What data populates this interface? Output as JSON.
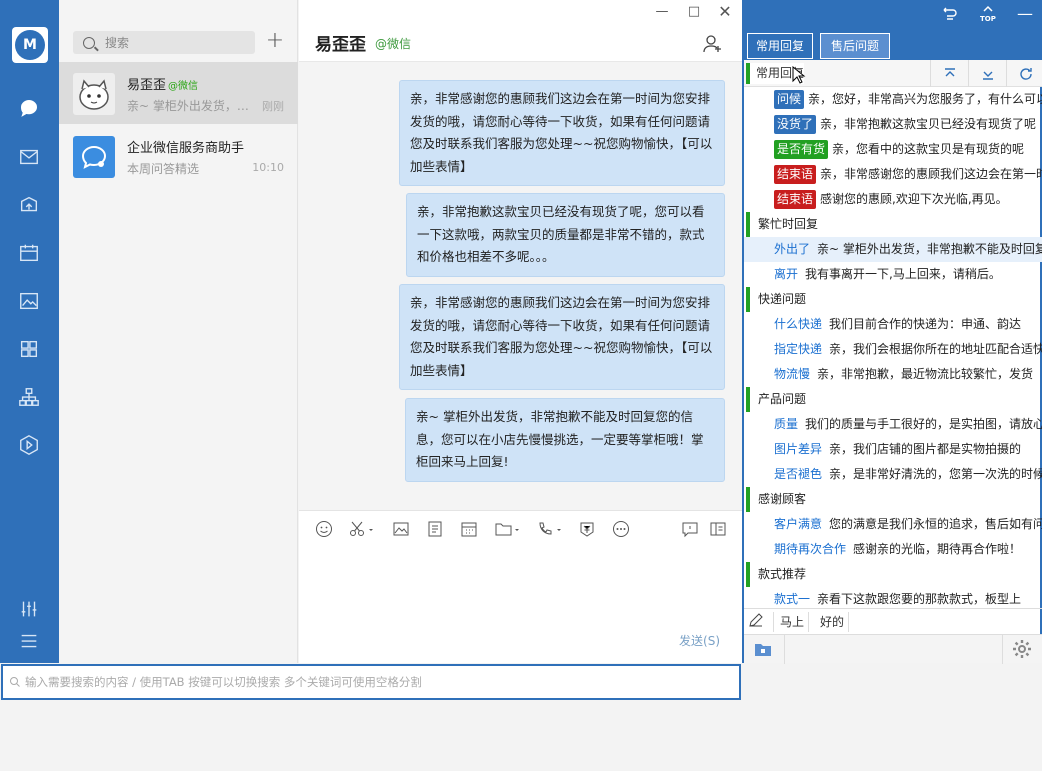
{
  "sidebar": {
    "logo_text": "M",
    "icons": [
      "chat-icon",
      "mail-icon",
      "box-icon",
      "calendar-icon",
      "image-icon",
      "apps-icon",
      "org-icon",
      "play-icon"
    ],
    "bottom_icons": [
      "settings-sliders-icon",
      "menu-icon"
    ]
  },
  "convlist": {
    "search_placeholder": "搜索",
    "items": [
      {
        "name": "易歪歪",
        "tag": "@微信",
        "preview": "亲~ 掌柜外出发货，非常抱歉不能及时回复",
        "time": "刚刚"
      },
      {
        "name": "企业微信服务商助手",
        "tag": "",
        "preview": "本周问答精选",
        "time": "10:10"
      }
    ]
  },
  "chat": {
    "title": "易歪歪",
    "subtitle": "@微信",
    "messages": [
      "亲，非常感谢您的惠顾我们这边会在第一时间为您安排发货的哦，请您耐心等待一下收货，如果有任何问题请您及时联系我们客服为您处理~~祝您购物愉快，【可以加些表情】",
      "亲，非常抱歉这款宝贝已经没有现货了呢，您可以看一下这款哦，两款宝贝的质量都是非常不错的，款式和价格也相差不多呢。。。",
      "亲，非常感谢您的惠顾我们这边会在第一时间为您安排发货的哦，请您耐心等待一下收货，如果有任何问题请您及时联系我们客服为您处理~~祝您购物愉快，【可以加些表情】",
      "亲~ 掌柜外出发货，非常抱歉不能及时回复您的信息，您可以在小店先慢慢挑选，一定要等掌柜哦！掌柜回来马上回复!"
    ],
    "send_label": "发送(S)"
  },
  "panel": {
    "tabs": [
      "常用回复",
      "售后问题"
    ],
    "first_group": "常用回复",
    "rows": [
      {
        "type": "item",
        "tag": "问候",
        "tag_color": "#2f70b9",
        "text": "亲，您好，非常高兴为您服务了，有什么可以帮您的"
      },
      {
        "type": "item",
        "tag": "没货了",
        "tag_color": "#2f70b9",
        "text": "亲，非常抱歉这款宝贝已经没有现货了呢"
      },
      {
        "type": "item",
        "tag": "是否有货",
        "tag_color": "#22a022",
        "text": "亲，您看中的这款宝贝是有现货的呢"
      },
      {
        "type": "item",
        "tag": "结束语",
        "tag_color": "#c81e1e",
        "text": "亲，非常感谢您的惠顾我们这边会在第一时间"
      },
      {
        "type": "item",
        "tag": "结束语",
        "tag_color": "#c81e1e",
        "text": "感谢您的惠顾,欢迎下次光临,再见。"
      },
      {
        "type": "group",
        "text": "繁忙时回复"
      },
      {
        "type": "link",
        "tag": "外出了",
        "text": "亲~ 掌柜外出发货，非常抱歉不能及时回复",
        "hl": true
      },
      {
        "type": "link",
        "tag": "离开",
        "text": "我有事离开一下,马上回来，请稍后。"
      },
      {
        "type": "group",
        "text": "快递问题"
      },
      {
        "type": "link",
        "tag": "什么快递",
        "text": "我们目前合作的快递为：申通、韵达"
      },
      {
        "type": "link",
        "tag": "指定快递",
        "text": "亲，我们会根据你所在的地址匹配合适快递"
      },
      {
        "type": "link",
        "tag": "物流慢",
        "text": "亲，非常抱歉，最近物流比较繁忙，发货"
      },
      {
        "type": "group",
        "text": "产品问题"
      },
      {
        "type": "link",
        "tag": "质量",
        "text": "我们的质量与手工很好的，是实拍图，请放心"
      },
      {
        "type": "link",
        "tag": "图片差异",
        "text": "亲，我们店铺的图片都是实物拍摄的"
      },
      {
        "type": "link",
        "tag": "是否褪色",
        "text": "亲，是非常好清洗的，您第一次洗的时候"
      },
      {
        "type": "group",
        "text": "感谢顾客"
      },
      {
        "type": "link",
        "tag": "客户满意",
        "text": "您的满意是我们永恒的追求，售后如有问题"
      },
      {
        "type": "link",
        "tag": "期待再次合作",
        "text": "感谢亲的光临，期待再合作啦！"
      },
      {
        "type": "group",
        "text": "款式推荐"
      },
      {
        "type": "link",
        "tag": "款式一",
        "text": "亲看下这款跟您要的那款款式，板型上"
      }
    ],
    "quick": [
      "马上",
      "好的"
    ]
  },
  "bottom_search": {
    "placeholder": "输入需要搜索的内容 / 使用TAB 按键可以切换搜索 多个关键词可使用空格分割"
  }
}
